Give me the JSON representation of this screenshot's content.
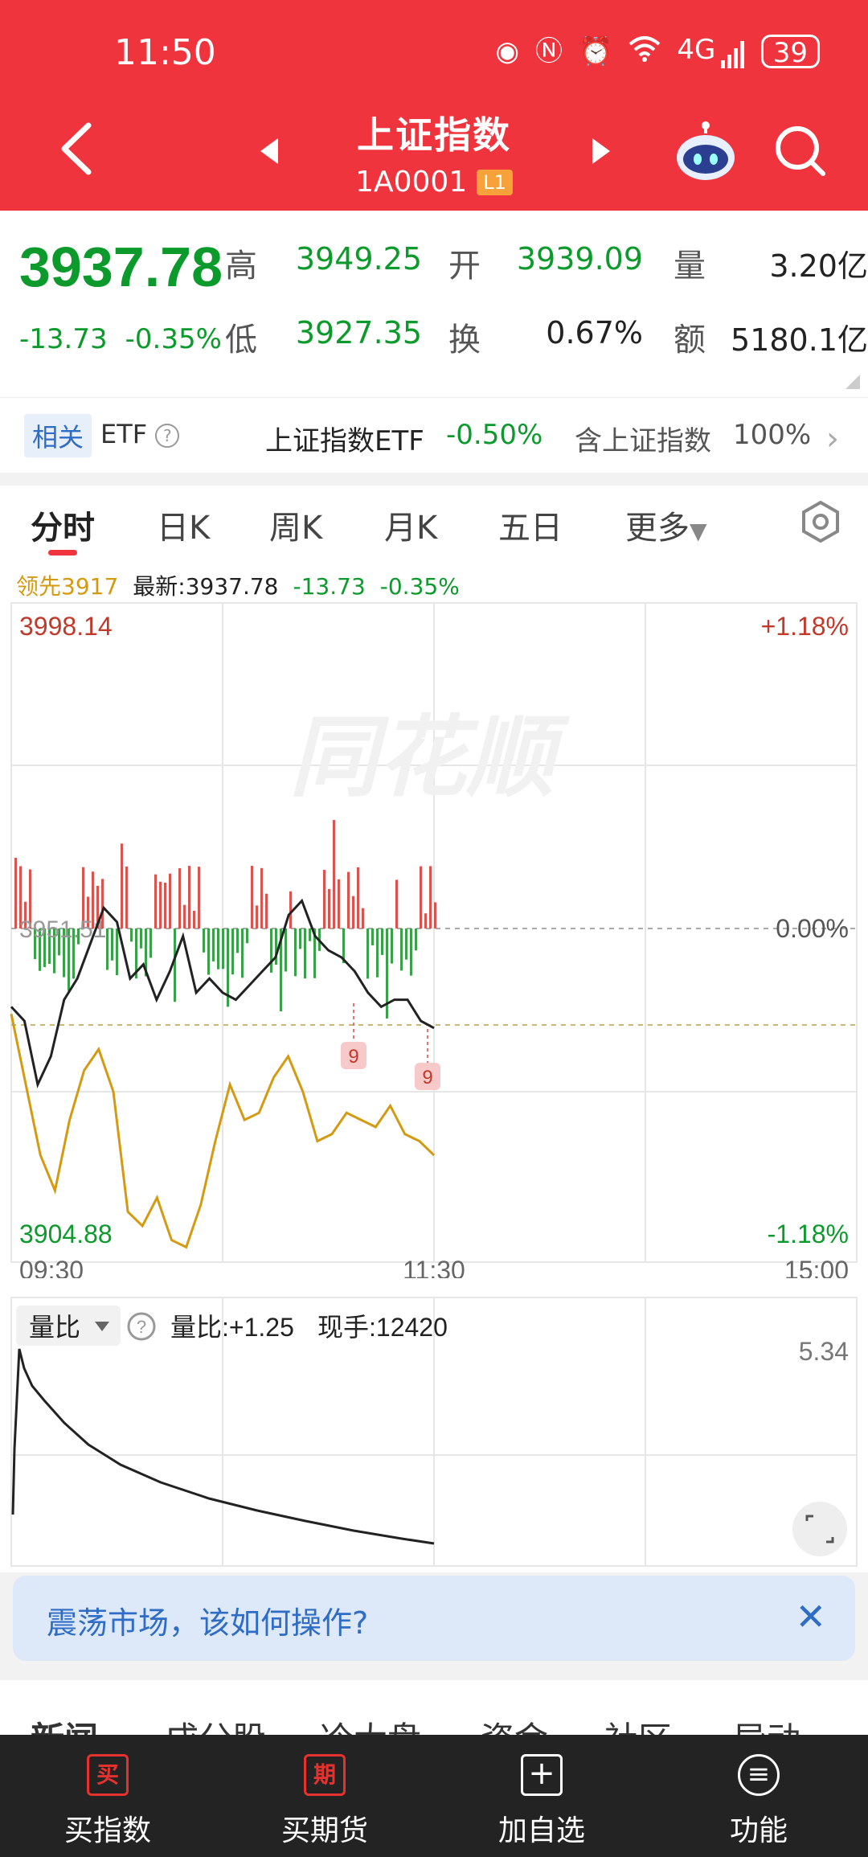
{
  "status": {
    "time": "11:50",
    "battery": "39",
    "network": "4G"
  },
  "header": {
    "title": "上证指数",
    "code": "1A0001",
    "level": "L1"
  },
  "quote": {
    "price": "3937.78",
    "change": "-13.73",
    "change_pct": "-0.35%",
    "high_label": "高",
    "high": "3949.25",
    "low_label": "低",
    "low": "3927.35",
    "open_label": "开",
    "open": "3939.09",
    "turnover_label": "换",
    "turnover": "0.67%",
    "volume_label": "量",
    "volume": "3.20亿",
    "amount_label": "额",
    "amount": "5180.1亿"
  },
  "etf": {
    "badge": "相关",
    "label": "ETF",
    "name": "上证指数ETF",
    "pct": "-0.50%",
    "contain_label": "含上证指数",
    "contain_value": "100%"
  },
  "tabs": [
    "分时",
    "日K",
    "周K",
    "月K",
    "五日",
    "更多"
  ],
  "legend": {
    "lead": "领先3917",
    "latest": "最新:3937.78",
    "change": "-13.73",
    "pct": "-0.35%"
  },
  "chart": {
    "top_price": "3998.14",
    "mid_price": "3951.51",
    "bottom_price": "3904.88",
    "top_pct": "+1.18%",
    "mid_pct": "0.00%",
    "bottom_pct": "-1.18%",
    "time_start": "09:30",
    "time_mid": "11:30",
    "time_end": "15:00",
    "watermark": "同花顺",
    "marker_label": "9"
  },
  "ratio": {
    "selector": "量比",
    "value": "量比:+1.25",
    "hand": "现手:12420",
    "max": "5.34"
  },
  "banner": {
    "text": "震荡市场，该如何操作?"
  },
  "news_tabs": [
    "新闻",
    "成分股",
    "冷大盘",
    "资金",
    "社区",
    "异动"
  ],
  "nav": [
    {
      "icon": "买",
      "label": "买指数"
    },
    {
      "icon": "期",
      "label": "买期货"
    },
    {
      "icon": "+",
      "label": "加自选"
    },
    {
      "icon": "≡",
      "label": "功能"
    }
  ],
  "colors": {
    "header": "#f0343d",
    "up": "#d1252f",
    "down": "#0d9a2c",
    "lead": "#d49a12"
  },
  "chart_data": {
    "type": "line",
    "x_range": [
      "09:30",
      "15:00"
    ],
    "ylim": [
      3904.88,
      3998.14
    ],
    "series": [
      {
        "values": [
          3941,
          3939,
          3930,
          3934,
          3942,
          3945,
          3950,
          3955,
          3953,
          3945,
          3947,
          3942,
          3946,
          3951,
          3943,
          3945,
          3943,
          3942,
          3944,
          3946,
          3948,
          3954,
          3956,
          3951,
          3949,
          3948,
          3946,
          3943,
          3941,
          3942,
          3942,
          3939,
          3938
        ]
      },
      {
        "values": [
          3940,
          3930,
          3920,
          3915,
          3925,
          3932,
          3935,
          3929,
          3912,
          3910,
          3914,
          3908,
          3907,
          3913,
          3922,
          3930,
          3925,
          3926,
          3931,
          3934,
          3929,
          3922,
          3923,
          3926,
          3925,
          3924,
          3927,
          3923,
          3922,
          3920
        ]
      }
    ]
  }
}
